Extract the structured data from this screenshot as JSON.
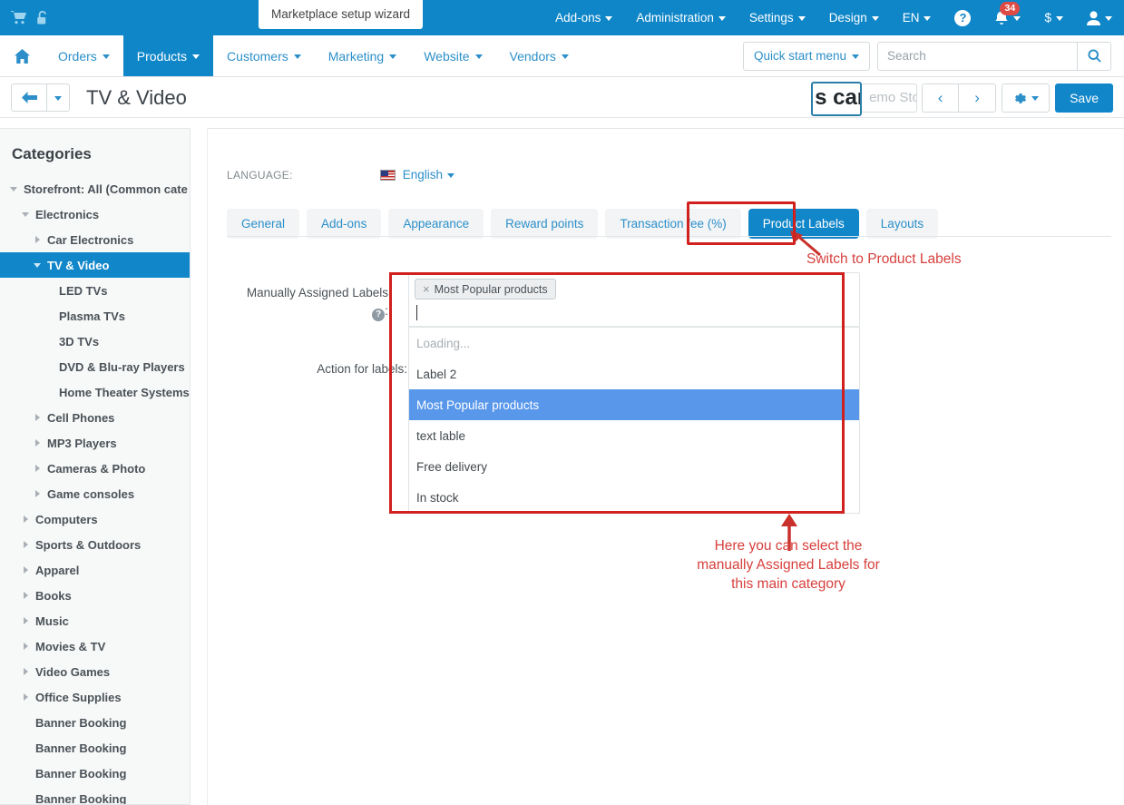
{
  "topbar": {
    "icons": [
      {
        "name": "cart-icon"
      },
      {
        "name": "unlock-icon"
      }
    ],
    "wizard_tooltip": "Marketplace setup wizard",
    "menus": [
      {
        "label": "Add-ons"
      },
      {
        "label": "Administration"
      },
      {
        "label": "Settings"
      },
      {
        "label": "Design"
      },
      {
        "label": "EN"
      }
    ],
    "help_icon_label": "?",
    "notifications_count": "34",
    "currency_label": "$",
    "accent_color": "#0f86c8"
  },
  "mainnav": {
    "home_icon": "home-icon",
    "items": [
      {
        "label": "Orders",
        "active": false
      },
      {
        "label": "Products",
        "active": true
      },
      {
        "label": "Customers",
        "active": false
      },
      {
        "label": "Marketing",
        "active": false
      },
      {
        "label": "Website",
        "active": false
      },
      {
        "label": "Vendors",
        "active": false
      }
    ],
    "quick_start_label": "Quick start menu",
    "search_placeholder": "Search",
    "search_value": ""
  },
  "titlebar": {
    "page_title": "TV & Video",
    "store_select_value": "emo Sto",
    "zoom_overlay_text": "s cart",
    "save_label": "Save",
    "prev_label": "‹",
    "next_label": "›"
  },
  "sidebar": {
    "title": "Categories",
    "items": [
      {
        "label": "Storefront: All (Common cate",
        "depth": 0,
        "toggle": "down",
        "selected": false
      },
      {
        "label": "Electronics",
        "depth": 1,
        "toggle": "down",
        "selected": false
      },
      {
        "label": "Car Electronics",
        "depth": 2,
        "toggle": "right",
        "selected": false
      },
      {
        "label": "TV & Video",
        "depth": 2,
        "toggle": "down",
        "selected": true
      },
      {
        "label": "LED TVs",
        "depth": 3,
        "toggle": "none",
        "selected": false
      },
      {
        "label": "Plasma TVs",
        "depth": 3,
        "toggle": "none",
        "selected": false
      },
      {
        "label": "3D TVs",
        "depth": 3,
        "toggle": "none",
        "selected": false
      },
      {
        "label": "DVD & Blu-ray Players",
        "depth": 3,
        "toggle": "none",
        "selected": false
      },
      {
        "label": "Home Theater Systems",
        "depth": 3,
        "toggle": "none",
        "selected": false
      },
      {
        "label": "Cell Phones",
        "depth": 2,
        "toggle": "right",
        "selected": false
      },
      {
        "label": "MP3 Players",
        "depth": 2,
        "toggle": "right",
        "selected": false
      },
      {
        "label": "Cameras & Photo",
        "depth": 2,
        "toggle": "right",
        "selected": false
      },
      {
        "label": "Game consoles",
        "depth": 2,
        "toggle": "right",
        "selected": false
      },
      {
        "label": "Computers",
        "depth": 1,
        "toggle": "right",
        "selected": false
      },
      {
        "label": "Sports & Outdoors",
        "depth": 1,
        "toggle": "right",
        "selected": false
      },
      {
        "label": "Apparel",
        "depth": 1,
        "toggle": "right",
        "selected": false
      },
      {
        "label": "Books",
        "depth": 1,
        "toggle": "right",
        "selected": false
      },
      {
        "label": "Music",
        "depth": 1,
        "toggle": "right",
        "selected": false
      },
      {
        "label": "Movies & TV",
        "depth": 1,
        "toggle": "right",
        "selected": false
      },
      {
        "label": "Video Games",
        "depth": 1,
        "toggle": "right",
        "selected": false
      },
      {
        "label": "Office Supplies",
        "depth": 1,
        "toggle": "right",
        "selected": false
      },
      {
        "label": "Banner Booking",
        "depth": 1,
        "toggle": "none",
        "selected": false
      },
      {
        "label": "Banner Booking",
        "depth": 1,
        "toggle": "none",
        "selected": false
      },
      {
        "label": "Banner Booking",
        "depth": 1,
        "toggle": "none",
        "selected": false
      },
      {
        "label": "Banner Booking",
        "depth": 1,
        "toggle": "none",
        "selected": false
      }
    ]
  },
  "content": {
    "language_label": "LANGUAGE:",
    "language_value": "English",
    "tabs": [
      {
        "label": "General",
        "active": false
      },
      {
        "label": "Add-ons",
        "active": false
      },
      {
        "label": "Appearance",
        "active": false
      },
      {
        "label": "Reward points",
        "active": false
      },
      {
        "label": "Transaction fee (%)",
        "active": false
      },
      {
        "label": "Product Labels",
        "active": true
      },
      {
        "label": "Layouts",
        "active": false
      }
    ],
    "form": {
      "manual_labels_label": "Manually Assigned Labels",
      "manual_labels_help": "?",
      "manual_labels_colon": ":",
      "action_for_labels_label": "Action for labels:",
      "selected_tokens": [
        {
          "label": "Most Popular products",
          "remove": "×"
        }
      ],
      "input_value": "",
      "dropdown_options": [
        {
          "label": "Loading...",
          "state": "loading"
        },
        {
          "label": "Label 2",
          "state": "normal"
        },
        {
          "label": "Most Popular products",
          "state": "highlight"
        },
        {
          "label": "text lable",
          "state": "normal"
        },
        {
          "label": "Free delivery",
          "state": "normal"
        },
        {
          "label": "In stock",
          "state": "normal"
        }
      ]
    }
  },
  "annotations": {
    "switch_tab": "Switch to Product Labels",
    "select_labels_line1": "Here you can select the",
    "select_labels_line2": "manually Assigned Labels for",
    "select_labels_line3": "this main category",
    "color": "#d6403d"
  }
}
